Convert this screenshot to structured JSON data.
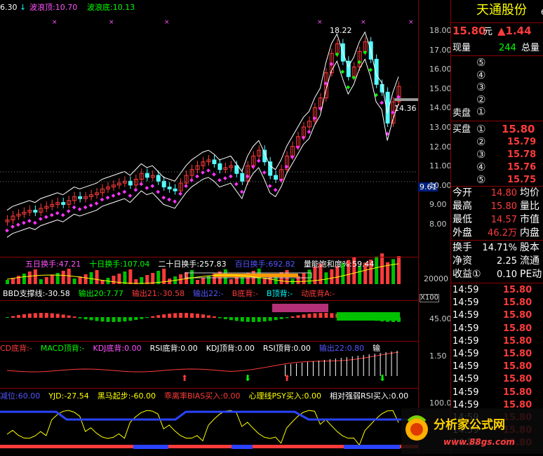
{
  "main": {
    "price_label": "6.30",
    "wave_top_label": "波浪顶:10.70",
    "wave_bottom_label": "波浪底:10.13",
    "high_mark": "18.22",
    "current_mark": "14.36",
    "low_mark": "9.61",
    "ticks": [
      "18.00",
      "17.00",
      "16.00",
      "15.00",
      "14.00",
      "13.00",
      "12.00",
      "11.00",
      "10.00",
      "9.00",
      "8.00"
    ]
  },
  "turnover": {
    "items": [
      {
        "label": "五日换手:47.21",
        "color": "#ff55ff"
      },
      {
        "label": "十日换手:107.04",
        "color": "#00ff00"
      },
      {
        "label": "二十日换手:257.83",
        "color": "#ffffff"
      },
      {
        "label": "百日换手:692.82",
        "color": "#5555ff"
      },
      {
        "label": "量能饱和度%:59.44",
        "color": "#ffffff"
      }
    ],
    "tick": "20000",
    "unit": "X100"
  },
  "bbd": {
    "items": [
      {
        "label": "BBD支撑线:-30.58",
        "color": "#ffffff"
      },
      {
        "label": "输出20:7.77",
        "color": "#00ff00"
      },
      {
        "label": "输出21:-30.58",
        "color": "#ff3b3b"
      },
      {
        "label": "输出22:-",
        "color": "#5555ff"
      },
      {
        "label": "B底背:-",
        "color": "#ff3b3b"
      },
      {
        "label": "B顶背:-",
        "color": "#00ffff"
      },
      {
        "label": "动底背A:-",
        "color": "#ff3b3b"
      }
    ],
    "tick": "45.00"
  },
  "macd": {
    "items": [
      {
        "label": "CD底背:-",
        "color": "#ff3b3b"
      },
      {
        "label": "MACD顶背:-",
        "color": "#00ff00"
      },
      {
        "label": "KDJ底背:0.00",
        "color": "#ff55ff"
      },
      {
        "label": "RSI底背:0.00",
        "color": "#ffffff"
      },
      {
        "label": "KDJ顶背:0.00",
        "color": "#ffffff"
      },
      {
        "label": "RSI顶背:0.00",
        "color": "#ffffff"
      },
      {
        "label": "输出22:0.80",
        "color": "#5555ff"
      },
      {
        "label": "输",
        "color": "#ffffff"
      }
    ],
    "tick": "1.50"
  },
  "yjd": {
    "items": [
      {
        "label": "减位:60.00",
        "color": "#5555ff"
      },
      {
        "label": "YJD:-27.54",
        "color": "#ffff00"
      },
      {
        "label": "黑马起步:-60.00",
        "color": "#ffff00"
      },
      {
        "label": "乖离率BIAS买入:0.00",
        "color": "#ff3b3b"
      },
      {
        "label": "心理线PSY买入:0.00",
        "color": "#ffff00"
      },
      {
        "label": "相对强弱RSI买入:0.00",
        "color": "#ffffff"
      }
    ],
    "tick": "100.0"
  },
  "side": {
    "stock_name": "天通股份",
    "stock_code_partial": "6",
    "price": "15.80",
    "price_unit": "元",
    "change": "▲1.44",
    "volume_label": "现量",
    "volume_value": "244",
    "total_label": "总量",
    "sell_label": "卖盘",
    "buy_label": "买盘",
    "asks": [
      "⑤",
      "④",
      "③",
      "②",
      "①"
    ],
    "bids": [
      {
        "n": "①",
        "price": "15.80"
      },
      {
        "n": "②",
        "price": "15.79"
      },
      {
        "n": "③",
        "price": "15.78"
      },
      {
        "n": "④",
        "price": "15.76"
      },
      {
        "n": "⑤",
        "price": "15.75"
      }
    ],
    "stats": [
      {
        "k": "今开",
        "v": "14.80",
        "k2": "均价"
      },
      {
        "k": "最高",
        "v": "15.80",
        "k2": "量比"
      },
      {
        "k": "最低",
        "v": "14.57",
        "k2": "市值"
      },
      {
        "k": "外盘",
        "v": "46.2万",
        "k2": "内盘"
      }
    ],
    "stats2": [
      {
        "k": "换手",
        "v": "14.71%",
        "k2": "股本"
      },
      {
        "k": "净资",
        "v": "2.25",
        "k2": "流通"
      },
      {
        "k": "收益①",
        "v": "0.10",
        "k2": "PE动"
      }
    ],
    "ticks": [
      {
        "t": "14:59",
        "p": "15.80"
      },
      {
        "t": "14:59",
        "p": "15.80"
      },
      {
        "t": "14:59",
        "p": "15.80"
      },
      {
        "t": "14:59",
        "p": "15.80"
      },
      {
        "t": "14:59",
        "p": "15.80"
      },
      {
        "t": "14:59",
        "p": "15.80"
      },
      {
        "t": "14:59",
        "p": "15.80"
      },
      {
        "t": "14:59",
        "p": "15.80"
      },
      {
        "t": "14:59",
        "p": "15.80"
      },
      {
        "t": "14:59",
        "p": "15.80"
      },
      {
        "t": "14:59",
        "p": "15.80"
      },
      {
        "t": "14:59",
        "p": "15.80"
      },
      {
        "t": "14:59",
        "p": "15.80"
      }
    ]
  },
  "logo": {
    "name": "分析家公式网",
    "url": "www.88gs.com"
  }
}
